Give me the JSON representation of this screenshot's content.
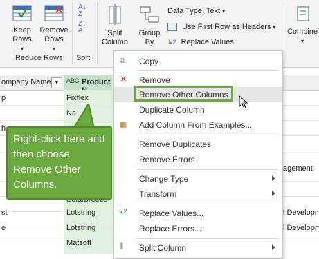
{
  "ribbon": {
    "keep_rows": "Keep\nRows",
    "remove_rows": "Remove\nRows",
    "reduce_rows_group": "Reduce Rows",
    "sort_group": "Sort",
    "split_column": "Split\nColumn",
    "group_by": "Group\nBy",
    "data_type": "Data Type: Text",
    "first_row_headers": "Use First Row as Headers",
    "replace_values": "Replace Values",
    "combine": "Combine"
  },
  "table": {
    "col1_header": "ompany Name",
    "col2_header": "Product N",
    "col2_type": "ABC",
    "col1_cells": [
      "p",
      "",
      "h",
      "",
      "",
      "",
      "st",
      "e",
      ""
    ],
    "col2_cells": [
      "Fixflex",
      "Na",
      "",
      "",
      "",
      "Solarbreeze",
      "Lotstring",
      "Lotstring",
      "Matsoft"
    ],
    "col3_cells": [
      "",
      "",
      "",
      "",
      "agement",
      "",
      "l Developm",
      "l Developm",
      ""
    ]
  },
  "context_menu": {
    "items": [
      {
        "label": "Copy"
      },
      {
        "label": "Remove"
      },
      {
        "label": "Remove Other Columns"
      },
      {
        "label": "Duplicate Column"
      },
      {
        "label": "Add Column From Examples..."
      },
      {
        "label": "Remove Duplicates"
      },
      {
        "label": "Remove Errors"
      },
      {
        "label": "Change Type"
      },
      {
        "label": "Transform"
      },
      {
        "label": "Replace Values..."
      },
      {
        "label": "Replace Errors..."
      },
      {
        "label": "Split Column"
      }
    ]
  },
  "callout": {
    "text": "Right-click here and then choose Remove Other Columns."
  },
  "colors": {
    "accent_green": "#6aaa3f",
    "highlight_border": "#6aaa3f",
    "column_fill": "#dff0df"
  }
}
